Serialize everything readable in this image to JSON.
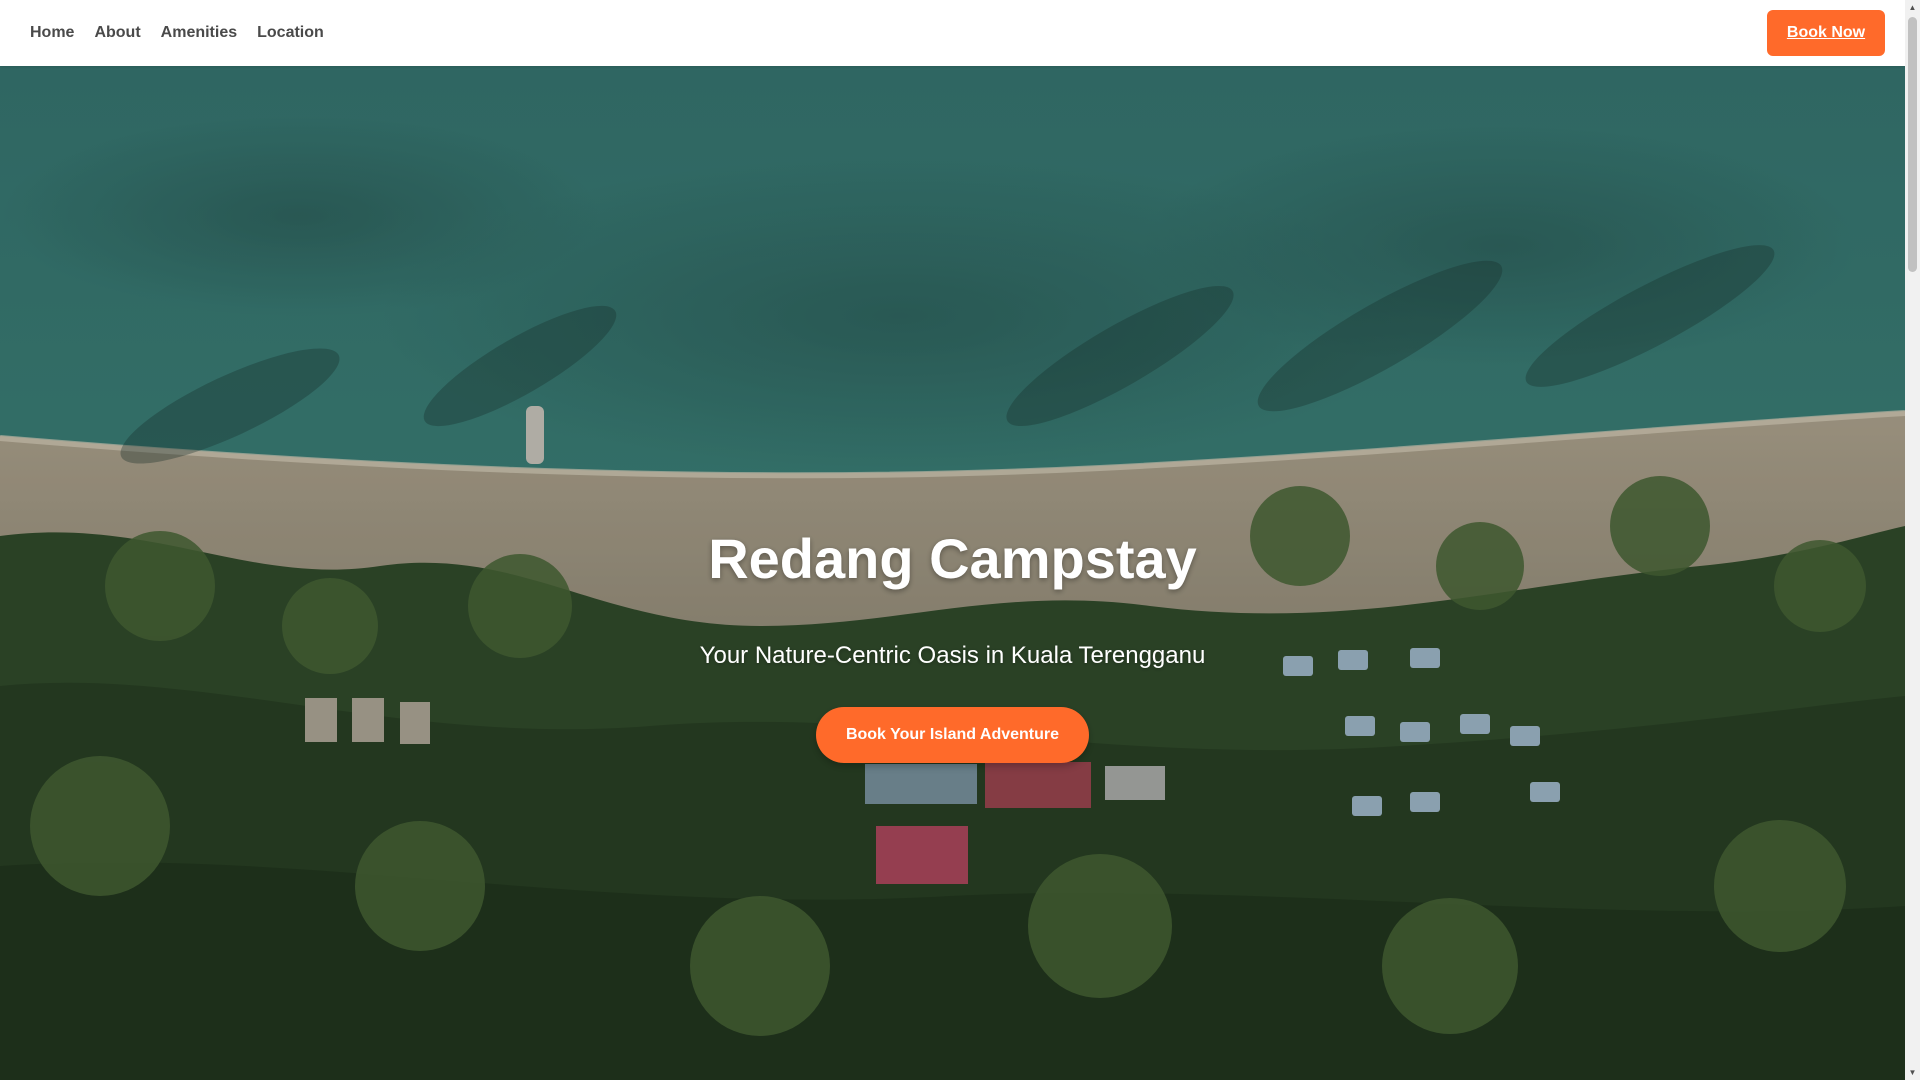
{
  "nav": {
    "links": [
      {
        "label": "Home"
      },
      {
        "label": "About"
      },
      {
        "label": "Amenities"
      },
      {
        "label": "Location"
      }
    ],
    "book_now_label": "Book Now"
  },
  "hero": {
    "title": "Redang Campstay",
    "subtitle": "Your Nature-Centric Oasis in Kuala Terengganu",
    "cta_label": "Book Your Island Adventure"
  },
  "colors": {
    "accent": "#ff6a2a",
    "nav_text": "#4a4a4a",
    "hero_text": "#ffffff",
    "sea_teal": "#2f7f7a",
    "sand": "#cdbfa6",
    "forest": "#2f4a2a"
  },
  "icons": {
    "scroll_up": "triangle-up",
    "scroll_down": "triangle-down"
  }
}
